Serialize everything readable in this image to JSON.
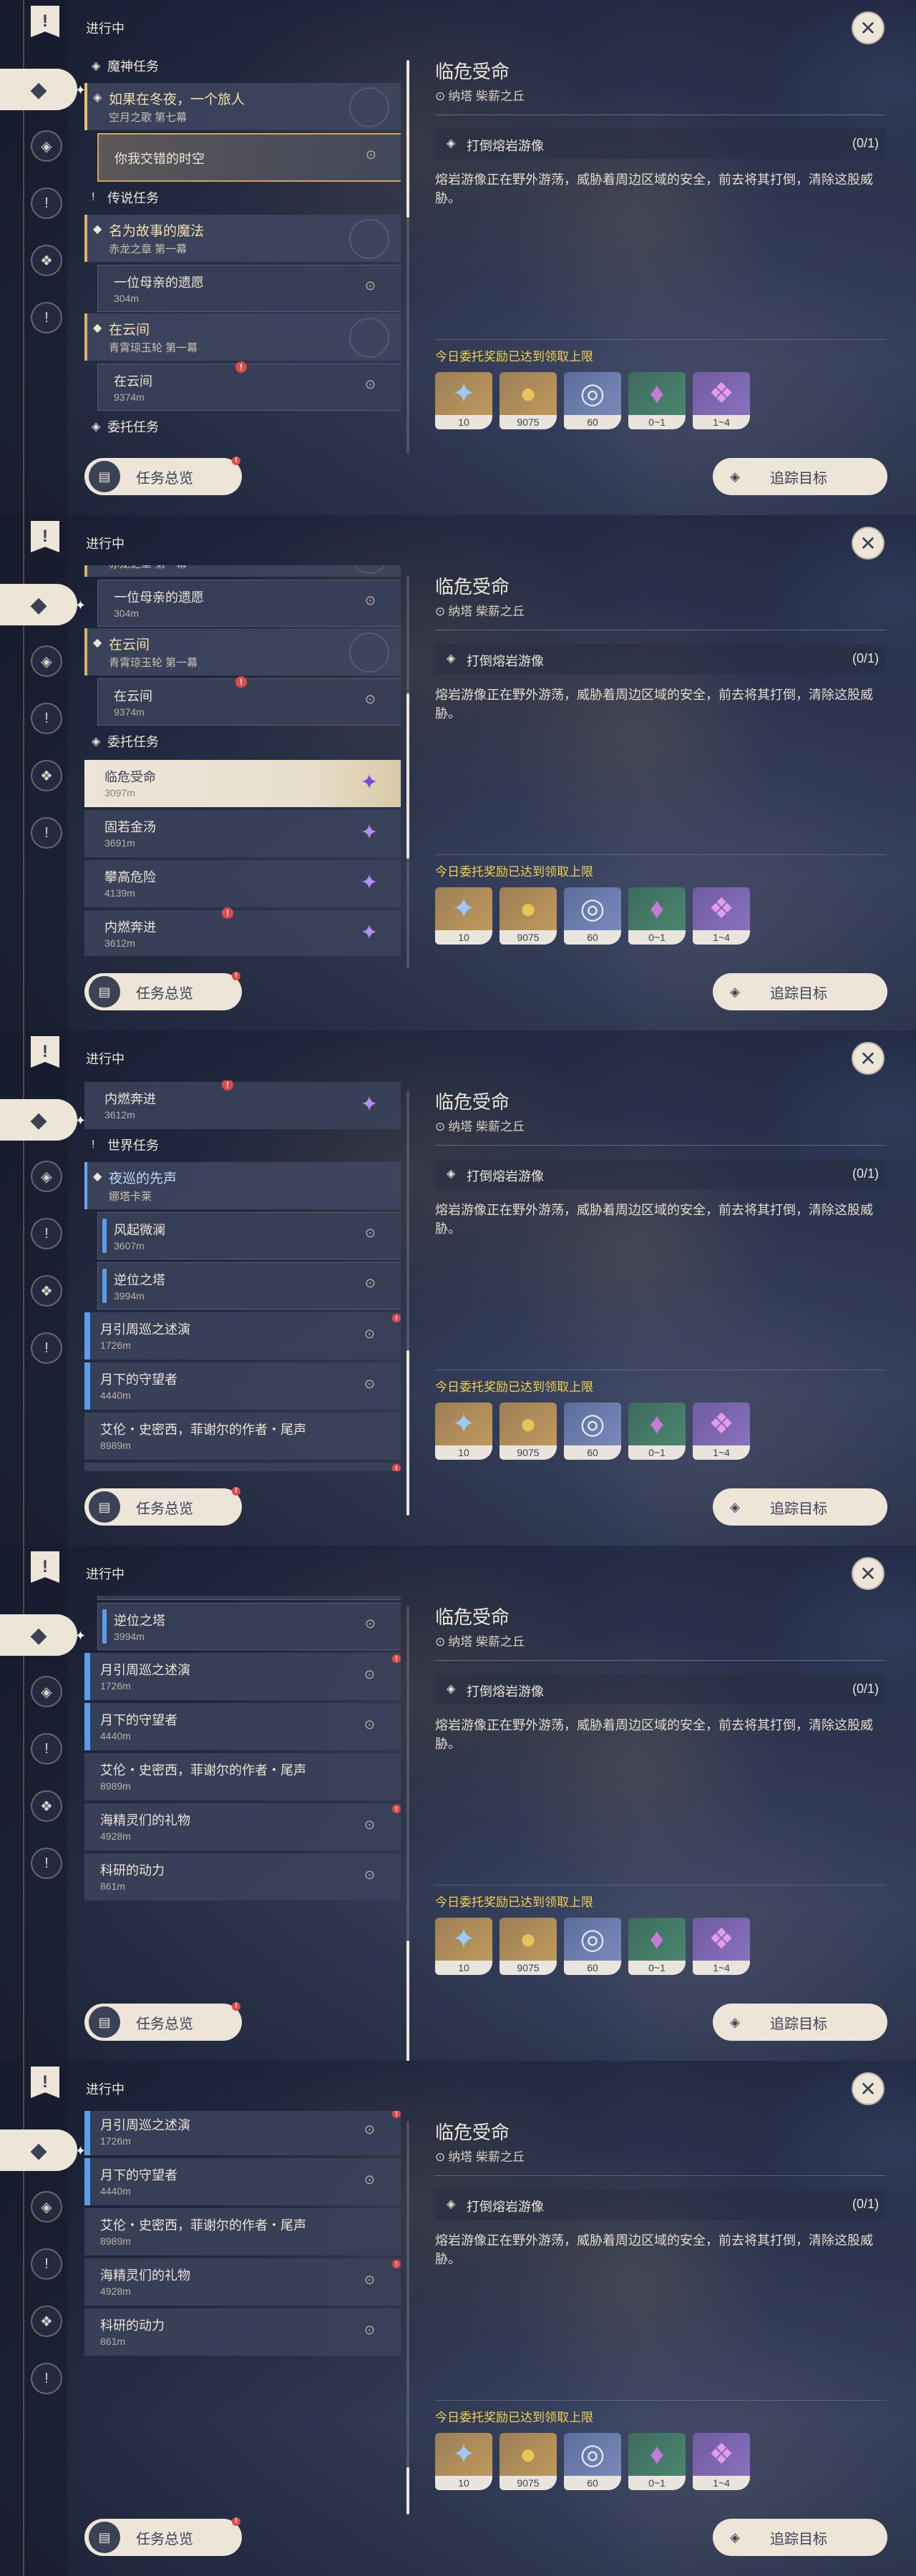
{
  "header": {
    "title": "进行中"
  },
  "close_label": "✕",
  "rail": {
    "icons": [
      "quest-tab-icon",
      "commission-tab-icon",
      "archon-tab-icon",
      "world-tab-icon",
      "legend-tab-icon"
    ]
  },
  "list": {
    "archon_section": "魔神任务",
    "legend_section": "传说任务",
    "commission_section": "委托任务",
    "world_section": "世界任务",
    "quests": {
      "winter": {
        "title": "如果在冬夜，一个旅人",
        "sub": "空月之歌 第七幕"
      },
      "winter_step": {
        "title": "你我交错的时空"
      },
      "magic": {
        "title": "名为故事的魔法",
        "sub": "赤龙之章 第一幕"
      },
      "mother": {
        "title": "一位母亲的遗愿",
        "dist": "304m"
      },
      "cloud": {
        "title": "在云间",
        "sub": "青霄琼玉轮 第一幕"
      },
      "cloud_step": {
        "title": "在云间",
        "dist": "9374m"
      }
    },
    "commissions": [
      {
        "title": "临危受命",
        "dist": "3097m"
      },
      {
        "title": "固若金汤",
        "dist": "3691m"
      },
      {
        "title": "攀高危险",
        "dist": "4139m"
      },
      {
        "title": "内燃奔进",
        "dist": "3612m"
      }
    ],
    "world": {
      "patrol": {
        "title": "夜巡的先声",
        "sub": "娜塔卡莱"
      },
      "steps": [
        {
          "title": "风起微澜",
          "dist": "3607m"
        },
        {
          "title": "逆位之塔",
          "dist": "3994m"
        }
      ],
      "quests": [
        {
          "title": "月引周巡之述演",
          "dist": "1726m"
        },
        {
          "title": "月下的守望者",
          "dist": "4440m"
        },
        {
          "title": "艾伦・史密西，菲谢尔的作者・尾声",
          "dist": "8989m"
        },
        {
          "title": "海精灵们的礼物",
          "dist": "4928m"
        },
        {
          "title": "科研的动力",
          "dist": "861m"
        }
      ]
    }
  },
  "buttons": {
    "overview": "任务总览",
    "track": "追踪目标"
  },
  "detail": {
    "title": "临危受命",
    "location": "纳塔 柴薪之丘",
    "objective": "打倒熔岩游像",
    "progress": "(0/1)",
    "description": "熔岩游像正在野外游荡，威胁着周边区域的安全，前去将其打倒，清除这股威胁。",
    "reward_note": "今日委托奖励已达到领取上限",
    "rewards": [
      {
        "icon": "adventure-exp-icon",
        "count": "10"
      },
      {
        "icon": "mora-icon",
        "count": "9075"
      },
      {
        "icon": "companionship-icon",
        "count": "60"
      },
      {
        "icon": "crystal-icon",
        "count": "0~1"
      },
      {
        "icon": "crystal-cluster-icon",
        "count": "1~4"
      }
    ]
  },
  "panels": [
    {
      "offset": 0,
      "thumb": [
        0,
        40
      ]
    },
    {
      "offset": -280,
      "thumb": [
        30,
        42
      ]
    },
    {
      "offset": -760,
      "thumb": [
        66,
        42
      ]
    },
    {
      "offset": -1004,
      "thumb": [
        85,
        42
      ]
    },
    {
      "offset": -1088,
      "thumb": [
        88,
        12
      ]
    }
  ]
}
